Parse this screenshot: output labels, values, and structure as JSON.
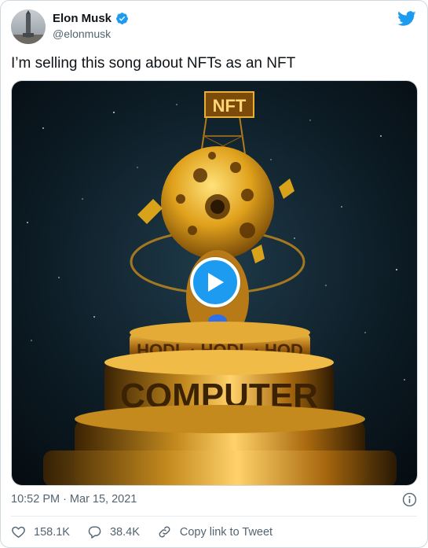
{
  "author": {
    "display_name": "Elon Musk",
    "handle": "@elonmusk",
    "verified": true
  },
  "tweet": {
    "text": "I’m selling this song about NFTs as an NFT",
    "time": "10:52 PM",
    "separator": "·",
    "date": "Mar 15, 2021"
  },
  "media": {
    "sign_text": "NFT",
    "ring_text_1": "HODL · HODL · HOD",
    "ring_text_2": "COMPUTER"
  },
  "actions": {
    "likes": "158.1K",
    "replies": "38.4K",
    "copy_link_label": "Copy link to Tweet"
  },
  "colors": {
    "twitter_blue": "#1d9bf0",
    "secondary_text": "#536471",
    "gold": "#d9a21b"
  },
  "icons": [
    "avatar",
    "verified-badge-icon",
    "twitter-bird-icon",
    "play-icon",
    "info-icon",
    "heart-icon",
    "reply-icon",
    "link-icon"
  ]
}
